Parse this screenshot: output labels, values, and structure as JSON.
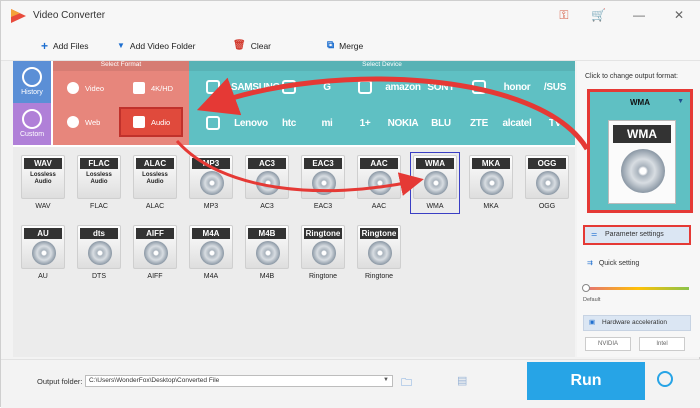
{
  "window": {
    "title": "Video Converter"
  },
  "toolbar": {
    "add_files": "Add Files",
    "add_video_folder": "Add Video Folder",
    "clear": "Clear",
    "merge": "Merge"
  },
  "sidebar": {
    "history": "History",
    "custom": "Custom"
  },
  "format_panel": {
    "header": "Select Format",
    "categories": [
      "Video",
      "4K/HD",
      "Web",
      "Audio"
    ]
  },
  "device_panel": {
    "header": "Select Device",
    "brands_row1": [
      "",
      "SAMSUNG",
      "",
      "G",
      "",
      "amazon",
      "SONY",
      "",
      "honor",
      "/SUS"
    ],
    "brands_row2": [
      "",
      "Lenovo",
      "htc",
      "mi",
      "1+",
      "NOKIA",
      "BLU",
      "ZTE",
      "alcatel",
      "TV"
    ]
  },
  "formats": [
    {
      "tag": "WAV",
      "label": "WAV",
      "lossless": true
    },
    {
      "tag": "FLAC",
      "label": "FLAC",
      "lossless": true
    },
    {
      "tag": "ALAC",
      "label": "ALAC",
      "lossless": true
    },
    {
      "tag": "MP3",
      "label": "MP3",
      "lossless": false
    },
    {
      "tag": "AC3",
      "label": "AC3",
      "lossless": false
    },
    {
      "tag": "EAC3",
      "label": "EAC3",
      "lossless": false
    },
    {
      "tag": "AAC",
      "label": "AAC",
      "lossless": false
    },
    {
      "tag": "WMA",
      "label": "WMA",
      "lossless": false
    },
    {
      "tag": "MKA",
      "label": "MKA",
      "lossless": false
    },
    {
      "tag": "OGG",
      "label": "OGG",
      "lossless": false
    },
    {
      "tag": "AU",
      "label": "AU",
      "lossless": false
    },
    {
      "tag": "dts",
      "label": "DTS",
      "lossless": false
    },
    {
      "tag": "AIFF",
      "label": "AIFF",
      "lossless": false
    },
    {
      "tag": "M4A",
      "label": "M4A",
      "lossless": false
    },
    {
      "tag": "M4B",
      "label": "M4B",
      "lossless": false
    },
    {
      "tag": "Ringtone",
      "label": "Ringtone",
      "lossless": false
    },
    {
      "tag": "Ringtone",
      "label": "Ringtone",
      "lossless": false
    }
  ],
  "lossless_text": "Lossless Audio",
  "selected_format": "WMA",
  "right_panel": {
    "hint": "Click to change output format:",
    "output_format": "WMA",
    "parameter_settings": "Parameter settings",
    "quick_setting": "Quick setting",
    "default_label": "Default",
    "hardware_acceleration": "Hardware acceleration",
    "nvidia": "NVIDIA",
    "intel": "Intel"
  },
  "bottom": {
    "output_folder_label": "Output folder:",
    "output_path": "C:\\Users\\WonderFox\\Desktop\\Converted File",
    "run": "Run"
  },
  "colors": {
    "format_panel": "#e7867c",
    "device_panel": "#5fc0c3",
    "run_button": "#27a4e6",
    "highlight": "#e53935"
  }
}
